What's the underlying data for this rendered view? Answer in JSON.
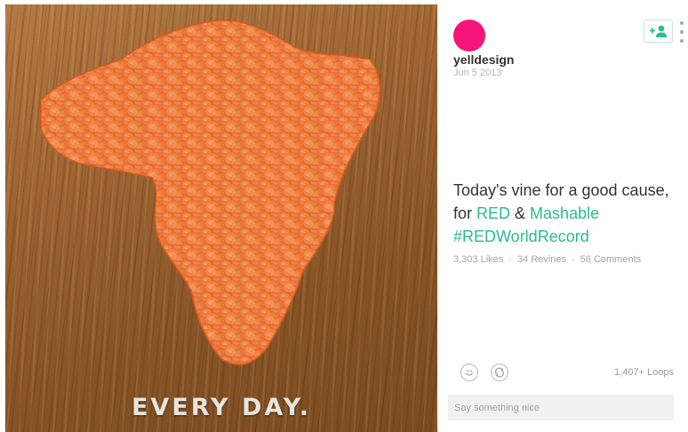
{
  "post": {
    "username": "yelldesign",
    "date": "Jun 5 2013",
    "avatar_color": "#f5157a",
    "video_overlay_text": "EVERY DAY.",
    "description": {
      "line1": "Today's vine for a good cause,",
      "line2_prefix": "for ",
      "link_red": "RED",
      "line2_mid": " & ",
      "link_mashable": "Mashable",
      "hashtag": "#REDWorldRecord"
    },
    "stats": {
      "likes": "3,303 Likes",
      "revines": "34 Revines",
      "comments": "56 Comments",
      "separator": "·"
    },
    "loops": "1,407+ Loops",
    "comment_placeholder": "Say something nice"
  },
  "icons": {
    "follow": "add-user-icon",
    "more": "more-vertical-icon",
    "like": "smiley-icon",
    "revine": "revine-icon"
  },
  "colors": {
    "accent": "#2bbc8a",
    "avatar": "#f5157a",
    "lentil": "#ec7a3c"
  }
}
